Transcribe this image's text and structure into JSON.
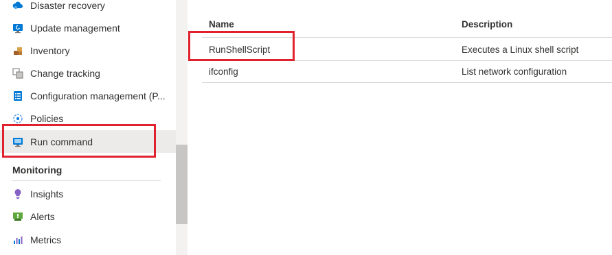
{
  "sidebar": {
    "items": [
      {
        "label": "Disaster recovery",
        "icon": "cloud-icon"
      },
      {
        "label": "Update management",
        "icon": "monitor-update-icon"
      },
      {
        "label": "Inventory",
        "icon": "boxes-icon"
      },
      {
        "label": "Change tracking",
        "icon": "change-tracking-icon"
      },
      {
        "label": "Configuration management (P...",
        "icon": "config-list-icon"
      },
      {
        "label": "Policies",
        "icon": "policy-icon"
      },
      {
        "label": "Run command",
        "icon": "run-command-icon",
        "selected": true
      }
    ],
    "monitoring_header": "Monitoring",
    "monitoring_items": [
      {
        "label": "Insights",
        "icon": "lightbulb-icon"
      },
      {
        "label": "Alerts",
        "icon": "alert-icon"
      },
      {
        "label": "Metrics",
        "icon": "metrics-icon"
      }
    ]
  },
  "table": {
    "headers": {
      "name": "Name",
      "description": "Description"
    },
    "rows": [
      {
        "name": "RunShellScript",
        "description": "Executes a Linux shell script"
      },
      {
        "name": "ifconfig",
        "description": "List network configuration"
      }
    ]
  },
  "colors": {
    "highlight": "#e0212e",
    "selected_bg": "#edebe9",
    "azure_blue": "#0078d4"
  }
}
